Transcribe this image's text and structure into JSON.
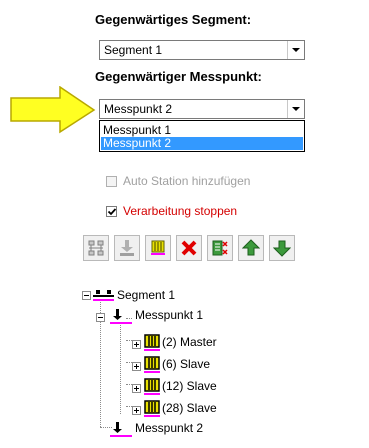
{
  "segment_heading": "Gegenwärtiges Segment:",
  "segment_select": {
    "value": "Segment 1"
  },
  "messpunkt_heading": "Gegenwärtiger Messpunkt:",
  "messpunkt_select": {
    "value": "Messpunkt 2",
    "options": [
      "Messpunkt 1",
      "Messpunkt 2"
    ],
    "selected_index": 1
  },
  "auto_station": {
    "label": "Auto Station hinzufügen",
    "checked": false,
    "enabled": false
  },
  "stop_processing": {
    "label": "Verarbeitung stoppen",
    "checked": true,
    "label_color": "#d40000"
  },
  "toolbar": {
    "buttons": [
      "network-icon",
      "download-station-icon",
      "device-icon",
      "delete-icon",
      "properties-icon",
      "move-up-icon",
      "move-down-icon"
    ]
  },
  "tree": {
    "root": "Segment 1",
    "messpunkt1": "Messpunkt 1",
    "devices": [
      "(2) Master",
      "(6) Slave",
      "(12) Slave",
      "(28) Slave"
    ],
    "messpunkt2": "Messpunkt 2"
  },
  "colors": {
    "arrow_fill": "#ffff22",
    "arrow_stroke": "#b8a800",
    "selection": "#3399ff",
    "accent_red": "#d40000",
    "magenta": "#ff00ff"
  }
}
